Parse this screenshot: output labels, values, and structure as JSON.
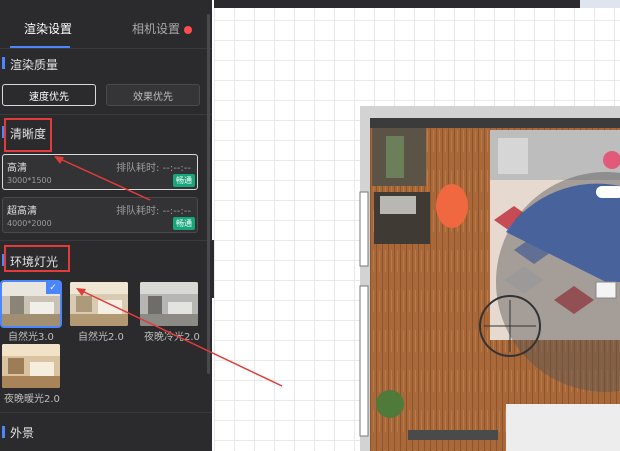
{
  "tabs": [
    {
      "label": "渲染设置",
      "active": true
    },
    {
      "label": "相机设置",
      "active": false,
      "badge": true
    }
  ],
  "render_quality": {
    "title": "渲染质量",
    "options": [
      "速度优先",
      "效果优先"
    ],
    "selected": "速度优先"
  },
  "resolution": {
    "title": "清晰度",
    "items": [
      {
        "name": "高清",
        "res": "3000*1500",
        "queue": "排队耗时: --:--:--",
        "tag": "畅通",
        "selected": true
      },
      {
        "name": "超高清",
        "res": "4000*2000",
        "queue": "排队耗时: --:--:--",
        "tag": "畅通",
        "selected": false
      }
    ]
  },
  "lighting": {
    "title": "环境灯光",
    "presets": [
      {
        "label": "自然光3.0",
        "selected": true
      },
      {
        "label": "自然光2.0",
        "selected": false
      },
      {
        "label": "夜晚冷光2.0",
        "selected": false
      },
      {
        "label": "夜晚暖光2.0",
        "selected": false
      }
    ]
  },
  "exterior": {
    "title": "外景"
  },
  "colors": {
    "accent": "#4c86ff",
    "panel_bg": "#2b2b2d",
    "annotation_red": "#e23b3b",
    "tag_green": "#17a57b"
  },
  "icons": {
    "collapse": "collapse-panel-icon",
    "check": "check-icon",
    "camera_rotate": "camera-rotate-icon"
  }
}
